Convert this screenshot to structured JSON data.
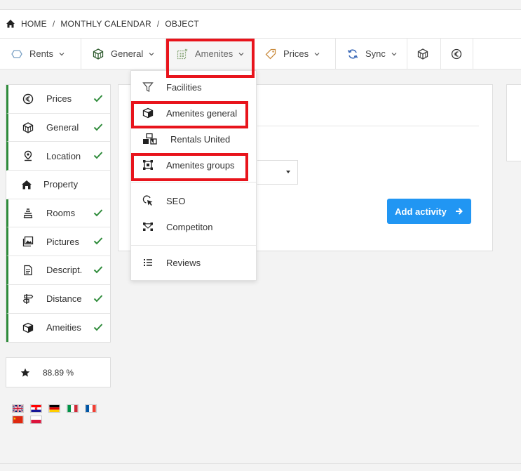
{
  "breadcrumb": {
    "items": [
      "HOME",
      "MONTHLY CALENDAR",
      "OBJECT"
    ],
    "separator": "/"
  },
  "tabs": [
    {
      "label": "Rents",
      "icon": "house-outline-icon",
      "has_dropdown": true
    },
    {
      "label": "General",
      "icon": "cube-box-icon",
      "has_dropdown": true
    },
    {
      "label": "Amenites",
      "icon": "amenities-grid-icon",
      "has_dropdown": true
    },
    {
      "label": "Prices",
      "icon": "price-tag-icon",
      "has_dropdown": true
    },
    {
      "label": "Sync",
      "icon": "sync-icon",
      "has_dropdown": true
    },
    {
      "label": "",
      "icon": "cube-box-icon",
      "has_dropdown": false
    },
    {
      "label": "",
      "icon": "euro-icon",
      "has_dropdown": false
    }
  ],
  "sidebar": {
    "items": [
      {
        "label": "Prices",
        "icon": "euro-icon",
        "completed": true
      },
      {
        "label": "General",
        "icon": "cube-box-icon",
        "completed": true
      },
      {
        "label": "Location",
        "icon": "location-pin-icon",
        "completed": true
      },
      {
        "label": "Property",
        "icon": "property-house-icon",
        "completed": false
      },
      {
        "label": "Rooms",
        "icon": "rooms-stack-icon",
        "completed": true
      },
      {
        "label": "Pictures",
        "icon": "pictures-icon",
        "completed": true
      },
      {
        "label": "Descript.",
        "icon": "document-icon",
        "completed": true
      },
      {
        "label": "Distance",
        "icon": "distance-sign-icon",
        "completed": true
      },
      {
        "label": "Ameities",
        "icon": "box-icon",
        "completed": true
      }
    ]
  },
  "score": {
    "value": "88.89 %",
    "icon": "star-icon"
  },
  "languages": [
    {
      "name": "english-flag",
      "colors": [
        "#012169",
        "#ffffff",
        "#c8102e"
      ]
    },
    {
      "name": "croatian-flag",
      "colors": [
        "#ff0000",
        "#ffffff",
        "#171796"
      ]
    },
    {
      "name": "german-flag",
      "colors": [
        "#000000",
        "#dd0000",
        "#ffce00"
      ]
    },
    {
      "name": "italian-flag",
      "colors": [
        "#009246",
        "#ffffff",
        "#ce2b37"
      ]
    },
    {
      "name": "french-flag",
      "colors": [
        "#0055a4",
        "#ffffff",
        "#ef4135"
      ]
    },
    {
      "name": "chinese-flag",
      "colors": [
        "#de2910",
        "#ffde00"
      ]
    },
    {
      "name": "polish-flag",
      "colors": [
        "#ffffff",
        "#dc143c"
      ]
    }
  ],
  "main": {
    "add_activity_label": "Add activity"
  },
  "dropdown": {
    "items": [
      {
        "label": "Facilities",
        "icon": "filter-icon"
      },
      {
        "label": "Amenites general",
        "icon": "cube-box-icon",
        "highlighted": true
      },
      {
        "label": "Rentals United",
        "icon": "boxes-icon"
      },
      {
        "label": "Amenites groups",
        "icon": "group-frame-icon",
        "highlighted": true
      },
      {
        "label": "SEO",
        "icon": "seo-cursor-icon"
      },
      {
        "label": "Competiton",
        "icon": "competition-network-icon"
      },
      {
        "label": "Reviews",
        "icon": "list-icon"
      }
    ]
  },
  "colors": {
    "accent": "#2196f3",
    "success": "#2e8b3a",
    "highlight": "#e8141c"
  }
}
